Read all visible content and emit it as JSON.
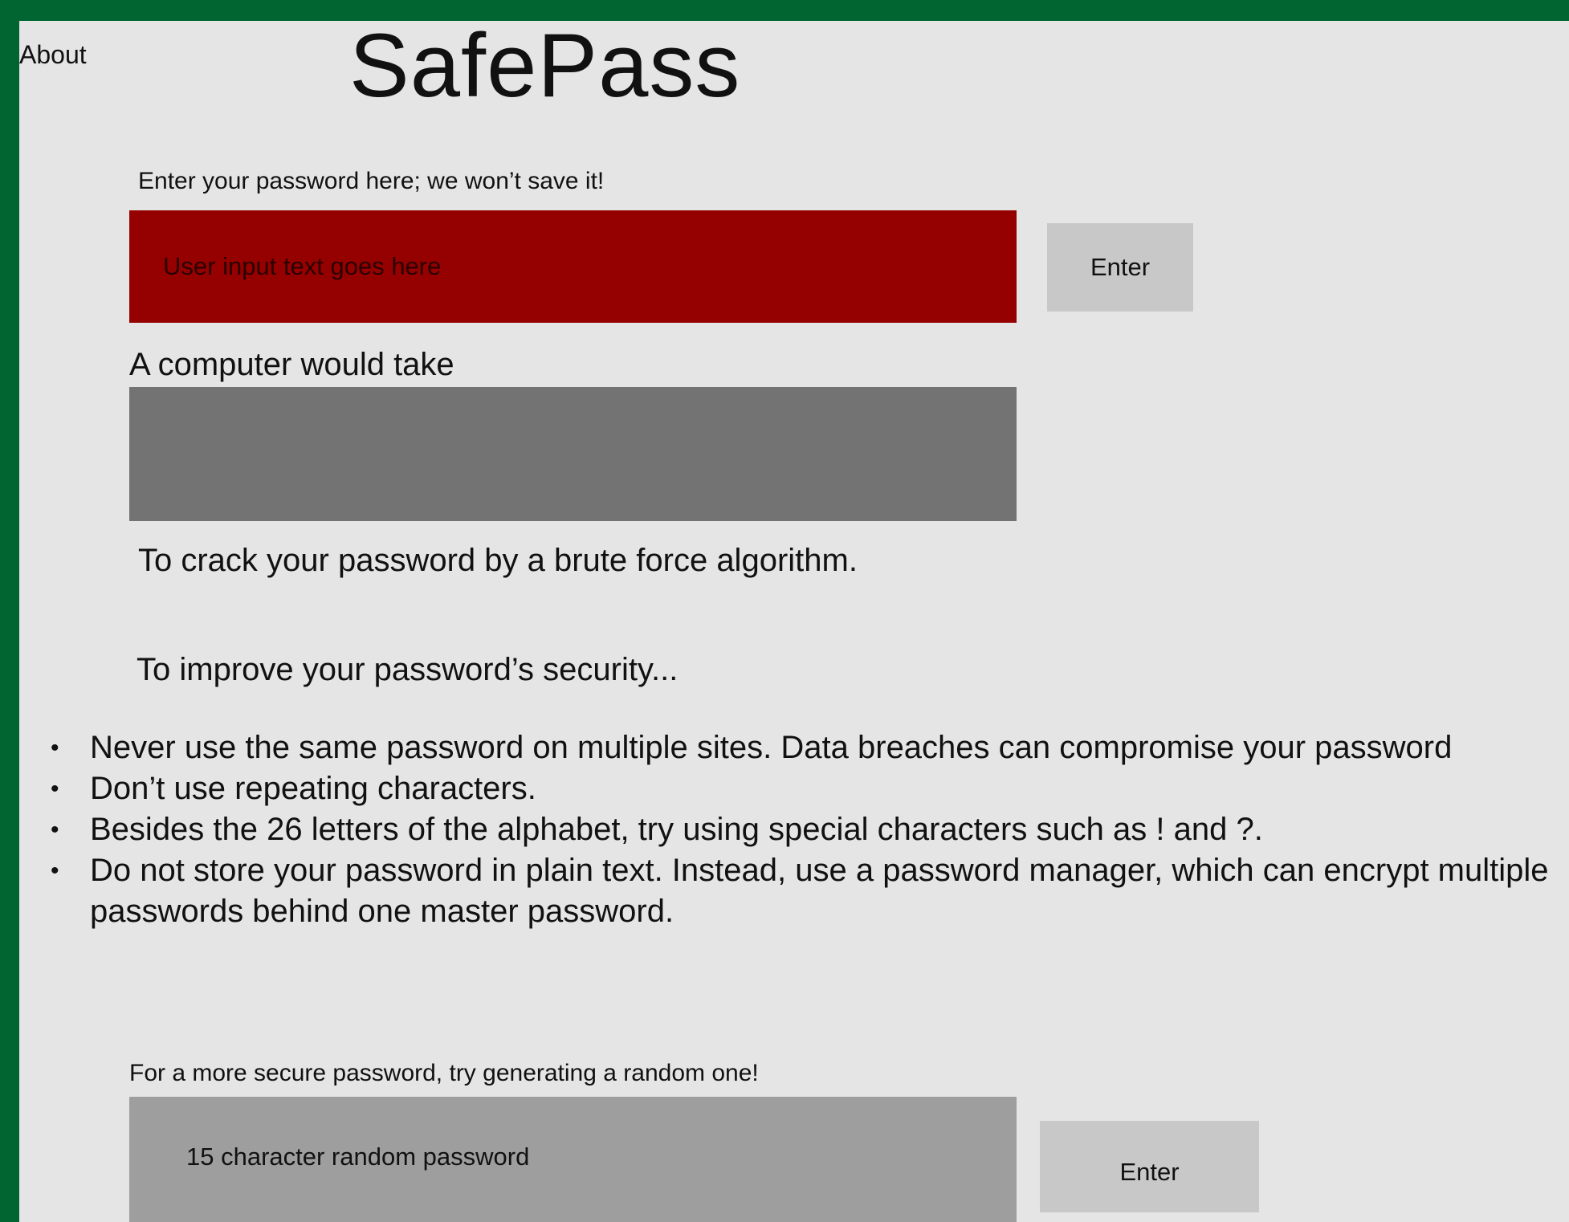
{
  "header": {
    "about_link": "About",
    "app_title": "SafePass"
  },
  "password_section": {
    "label": "Enter your password here; we won’t save it!",
    "input_placeholder": "User input text goes here",
    "enter_button": "Enter",
    "input_color": "#950000"
  },
  "result_section": {
    "heading": "A computer would take",
    "result_value": "",
    "caption": "To crack your password by a brute force algorithm."
  },
  "tips_section": {
    "heading": "To improve your password’s security...",
    "tips": [
      "Never use the same password on multiple sites. Data breaches can compromise your password",
      "Don’t use repeating characters.",
      "Besides the 26 letters of the alphabet, try using special characters such as ! and ?.",
      "Do not store your password in plain text. Instead, use a password manager, which can encrypt multiple passwords behind one master password."
    ]
  },
  "generator_section": {
    "label": "For a more secure password, try generating a random one!",
    "output_text": "15 character random password",
    "enter_button": "Enter"
  },
  "colors": {
    "frame": "#006530",
    "panel": "#e5e5e5",
    "result_box": "#737373",
    "generator_box": "#9e9e9e",
    "button": "#c8c8c8"
  }
}
